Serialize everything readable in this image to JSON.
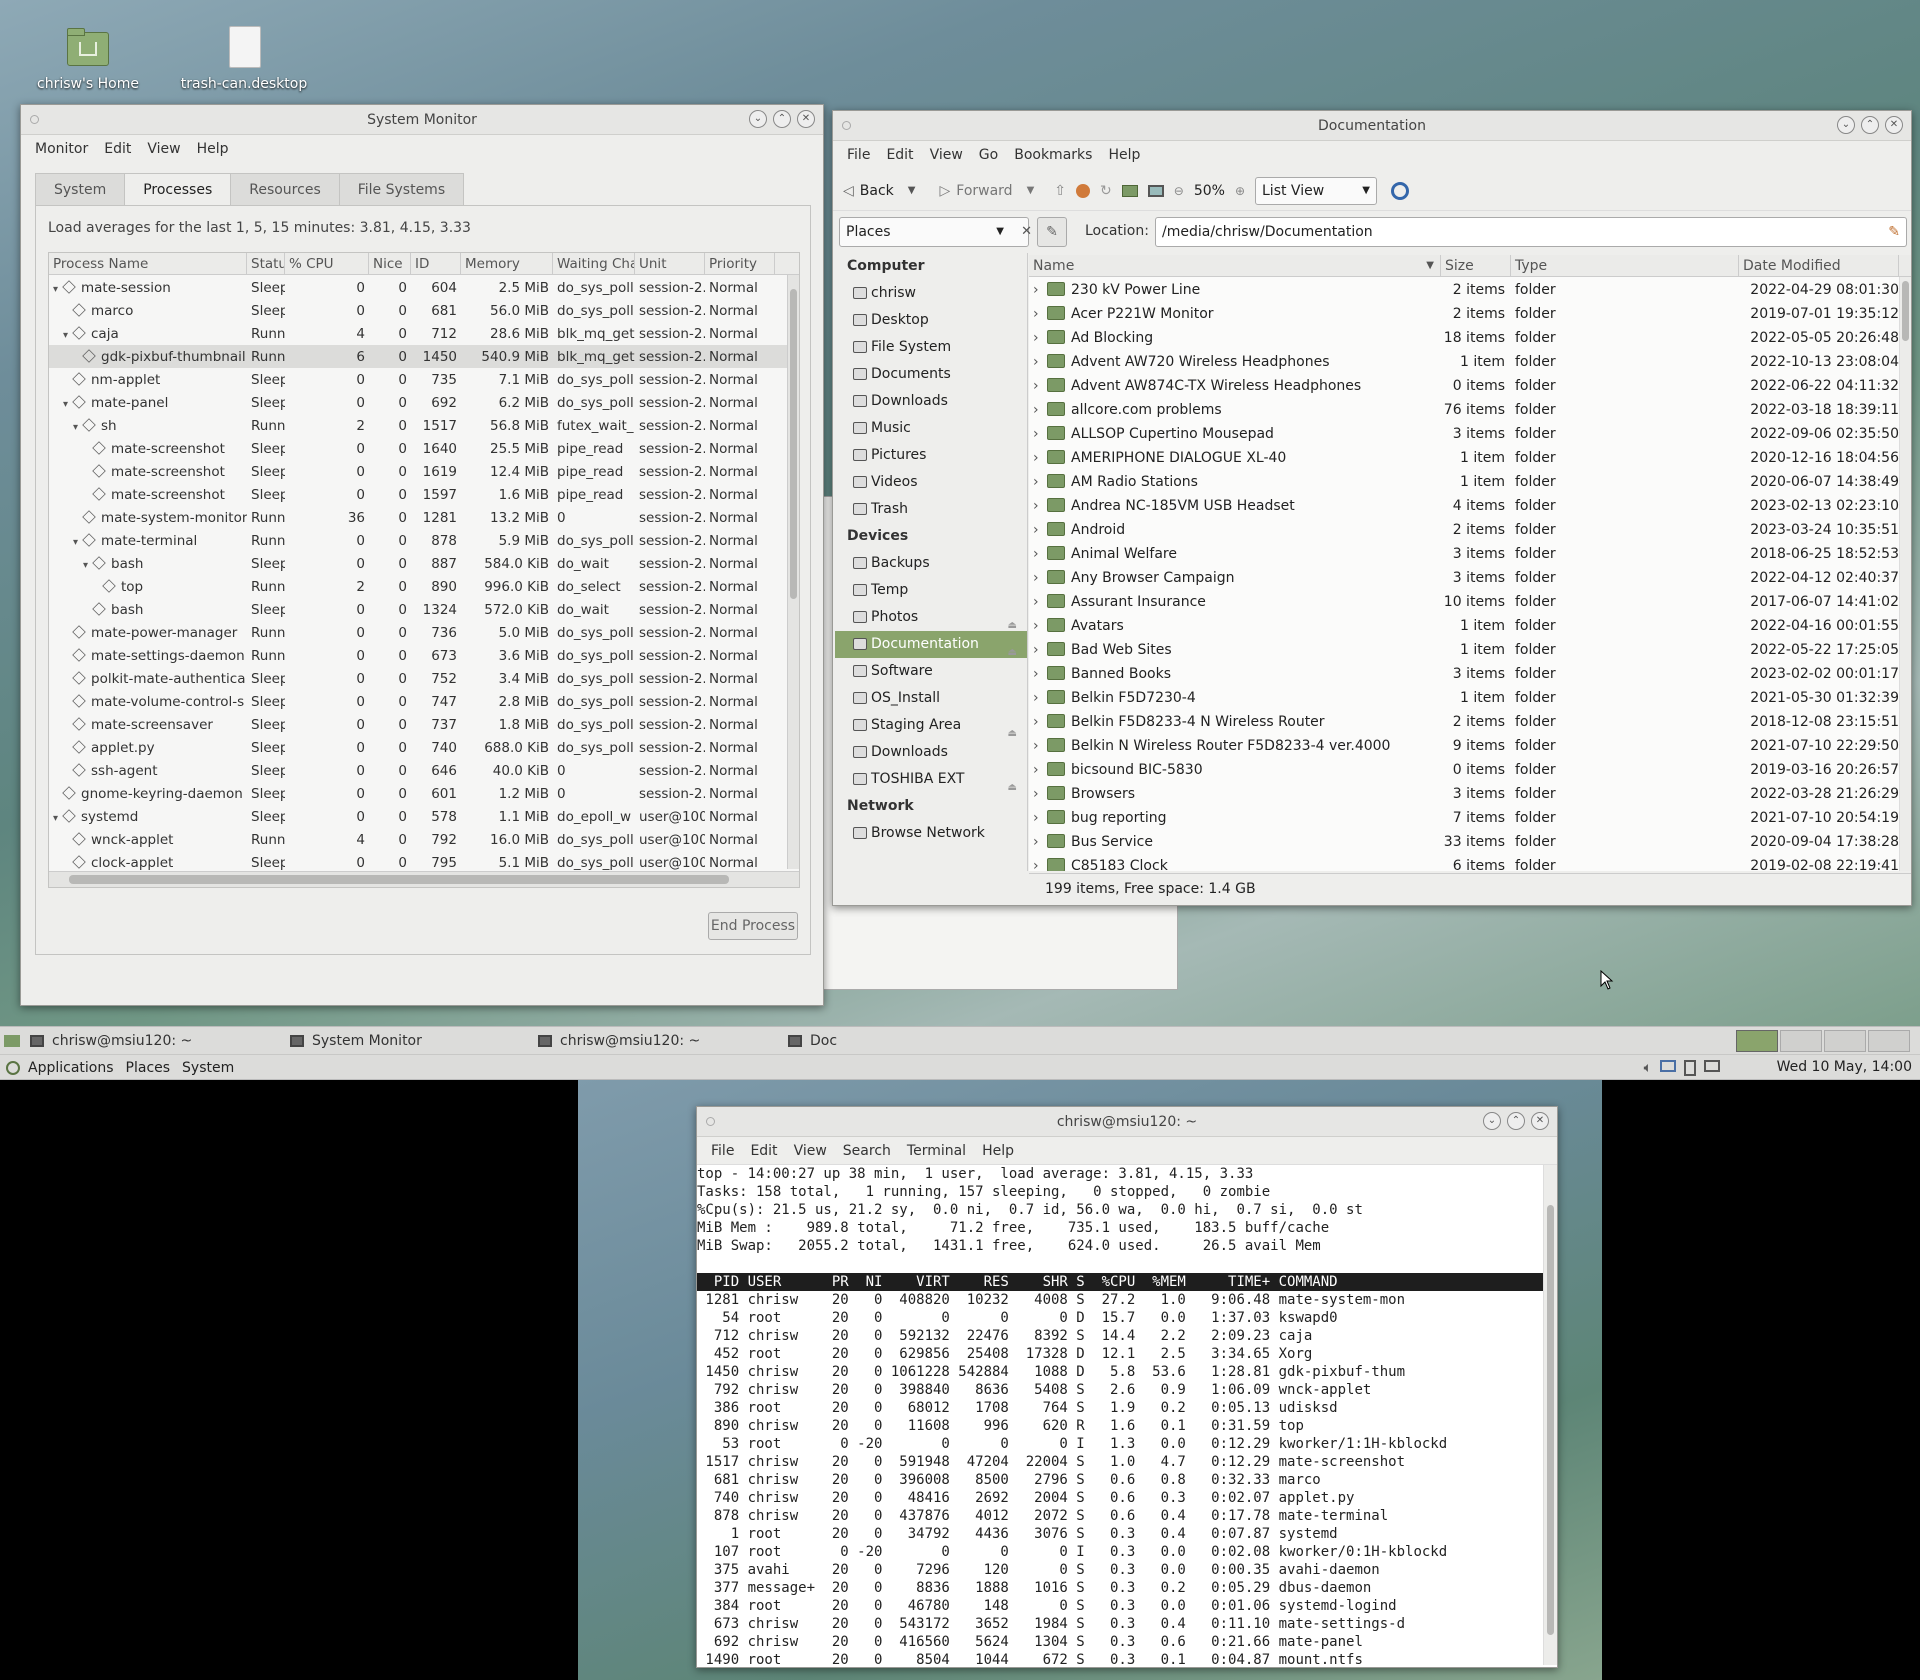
{
  "desktop": {
    "icons": [
      {
        "label": "chrisw's Home"
      },
      {
        "label": "trash-can.desktop"
      }
    ]
  },
  "sysmon": {
    "title": "System Monitor",
    "menu": [
      "Monitor",
      "Edit",
      "View",
      "Help"
    ],
    "tabs": [
      "System",
      "Processes",
      "Resources",
      "File Systems"
    ],
    "load_text": "Load averages for the last 1, 5, 15 minutes: 3.81, 4.15, 3.33",
    "columns": [
      "Process Name",
      "Statu",
      "% CPU",
      "Nice",
      "ID",
      "Memory",
      "Waiting Cha",
      "Unit",
      "Priority"
    ],
    "rows": [
      {
        "indent": 0,
        "exp": "▾",
        "name": "mate-session",
        "status": "Sleep",
        "cpu": "0",
        "nice": "0",
        "id": "604",
        "mem": "2.5 MiB",
        "wait": "do_sys_poll",
        "unit": "session-2.",
        "prio": "Normal"
      },
      {
        "indent": 1,
        "exp": "",
        "name": "marco",
        "status": "Sleep",
        "cpu": "0",
        "nice": "0",
        "id": "681",
        "mem": "56.0 MiB",
        "wait": "do_sys_poll",
        "unit": "session-2.",
        "prio": "Normal"
      },
      {
        "indent": 1,
        "exp": "▾",
        "name": "caja",
        "status": "Runn",
        "cpu": "4",
        "nice": "0",
        "id": "712",
        "mem": "28.6 MiB",
        "wait": "blk_mq_get",
        "unit": "session-2.",
        "prio": "Normal"
      },
      {
        "indent": 2,
        "exp": "",
        "name": "gdk-pixbuf-thumbnail",
        "status": "Runn",
        "cpu": "6",
        "nice": "0",
        "id": "1450",
        "mem": "540.9 MiB",
        "wait": "blk_mq_get",
        "unit": "session-2.",
        "prio": "Normal"
      },
      {
        "indent": 1,
        "exp": "",
        "name": "nm-applet",
        "status": "Sleep",
        "cpu": "0",
        "nice": "0",
        "id": "735",
        "mem": "7.1 MiB",
        "wait": "do_sys_poll",
        "unit": "session-2.",
        "prio": "Normal"
      },
      {
        "indent": 1,
        "exp": "▾",
        "name": "mate-panel",
        "status": "Sleep",
        "cpu": "0",
        "nice": "0",
        "id": "692",
        "mem": "6.2 MiB",
        "wait": "do_sys_poll",
        "unit": "session-2.",
        "prio": "Normal"
      },
      {
        "indent": 2,
        "exp": "▾",
        "name": "sh",
        "status": "Runn",
        "cpu": "2",
        "nice": "0",
        "id": "1517",
        "mem": "56.8 MiB",
        "wait": "futex_wait_",
        "unit": "session-2.",
        "prio": "Normal"
      },
      {
        "indent": 3,
        "exp": "",
        "name": "mate-screenshot",
        "status": "Sleep",
        "cpu": "0",
        "nice": "0",
        "id": "1640",
        "mem": "25.5 MiB",
        "wait": "pipe_read",
        "unit": "session-2.",
        "prio": "Normal"
      },
      {
        "indent": 3,
        "exp": "",
        "name": "mate-screenshot",
        "status": "Sleep",
        "cpu": "0",
        "nice": "0",
        "id": "1619",
        "mem": "12.4 MiB",
        "wait": "pipe_read",
        "unit": "session-2.",
        "prio": "Normal"
      },
      {
        "indent": 3,
        "exp": "",
        "name": "mate-screenshot",
        "status": "Sleep",
        "cpu": "0",
        "nice": "0",
        "id": "1597",
        "mem": "1.6 MiB",
        "wait": "pipe_read",
        "unit": "session-2.",
        "prio": "Normal"
      },
      {
        "indent": 2,
        "exp": "",
        "name": "mate-system-monitor",
        "status": "Runn",
        "cpu": "36",
        "nice": "0",
        "id": "1281",
        "mem": "13.2 MiB",
        "wait": "0",
        "unit": "session-2.",
        "prio": "Normal"
      },
      {
        "indent": 2,
        "exp": "▾",
        "name": "mate-terminal",
        "status": "Runn",
        "cpu": "0",
        "nice": "0",
        "id": "878",
        "mem": "5.9 MiB",
        "wait": "do_sys_poll",
        "unit": "session-2.",
        "prio": "Normal"
      },
      {
        "indent": 3,
        "exp": "▾",
        "name": "bash",
        "status": "Sleep",
        "cpu": "0",
        "nice": "0",
        "id": "887",
        "mem": "584.0 KiB",
        "wait": "do_wait",
        "unit": "session-2.",
        "prio": "Normal"
      },
      {
        "indent": 4,
        "exp": "",
        "name": "top",
        "status": "Runn",
        "cpu": "2",
        "nice": "0",
        "id": "890",
        "mem": "996.0 KiB",
        "wait": "do_select",
        "unit": "session-2.",
        "prio": "Normal"
      },
      {
        "indent": 3,
        "exp": "",
        "name": "bash",
        "status": "Sleep",
        "cpu": "0",
        "nice": "0",
        "id": "1324",
        "mem": "572.0 KiB",
        "wait": "do_wait",
        "unit": "session-2.",
        "prio": "Normal"
      },
      {
        "indent": 1,
        "exp": "",
        "name": "mate-power-manager",
        "status": "Runn",
        "cpu": "0",
        "nice": "0",
        "id": "736",
        "mem": "5.0 MiB",
        "wait": "do_sys_poll",
        "unit": "session-2.",
        "prio": "Normal"
      },
      {
        "indent": 1,
        "exp": "",
        "name": "mate-settings-daemon",
        "status": "Runn",
        "cpu": "0",
        "nice": "0",
        "id": "673",
        "mem": "3.6 MiB",
        "wait": "do_sys_poll",
        "unit": "session-2.",
        "prio": "Normal"
      },
      {
        "indent": 1,
        "exp": "",
        "name": "polkit-mate-authentica",
        "status": "Sleep",
        "cpu": "0",
        "nice": "0",
        "id": "752",
        "mem": "3.4 MiB",
        "wait": "do_sys_poll",
        "unit": "session-2.",
        "prio": "Normal"
      },
      {
        "indent": 1,
        "exp": "",
        "name": "mate-volume-control-s",
        "status": "Sleep",
        "cpu": "0",
        "nice": "0",
        "id": "747",
        "mem": "2.8 MiB",
        "wait": "do_sys_poll",
        "unit": "session-2.",
        "prio": "Normal"
      },
      {
        "indent": 1,
        "exp": "",
        "name": "mate-screensaver",
        "status": "Sleep",
        "cpu": "0",
        "nice": "0",
        "id": "737",
        "mem": "1.8 MiB",
        "wait": "do_sys_poll",
        "unit": "session-2.",
        "prio": "Normal"
      },
      {
        "indent": 1,
        "exp": "",
        "name": "applet.py",
        "status": "Sleep",
        "cpu": "0",
        "nice": "0",
        "id": "740",
        "mem": "688.0 KiB",
        "wait": "do_sys_poll",
        "unit": "session-2.",
        "prio": "Normal"
      },
      {
        "indent": 1,
        "exp": "",
        "name": "ssh-agent",
        "status": "Sleep",
        "cpu": "0",
        "nice": "0",
        "id": "646",
        "mem": "40.0 KiB",
        "wait": "0",
        "unit": "session-2.",
        "prio": "Normal"
      },
      {
        "indent": 0,
        "exp": "",
        "name": "gnome-keyring-daemon",
        "status": "Sleep",
        "cpu": "0",
        "nice": "0",
        "id": "601",
        "mem": "1.2 MiB",
        "wait": "0",
        "unit": "session-2.",
        "prio": "Normal"
      },
      {
        "indent": 0,
        "exp": "▾",
        "name": "systemd",
        "status": "Sleep",
        "cpu": "0",
        "nice": "0",
        "id": "578",
        "mem": "1.1 MiB",
        "wait": "do_epoll_w",
        "unit": "user@100",
        "prio": "Normal"
      },
      {
        "indent": 1,
        "exp": "",
        "name": "wnck-applet",
        "status": "Runn",
        "cpu": "4",
        "nice": "0",
        "id": "792",
        "mem": "16.0 MiB",
        "wait": "do_sys_poll",
        "unit": "user@100",
        "prio": "Normal"
      },
      {
        "indent": 1,
        "exp": "",
        "name": "clock-applet",
        "status": "Sleep",
        "cpu": "0",
        "nice": "0",
        "id": "795",
        "mem": "5.1 MiB",
        "wait": "do_sys_poll",
        "unit": "user@100",
        "prio": "Normal"
      }
    ],
    "end_button": "End Process"
  },
  "files": {
    "title": "Documentation",
    "menu": [
      "File",
      "Edit",
      "View",
      "Go",
      "Bookmarks",
      "Help"
    ],
    "toolbar": {
      "back": "Back",
      "forward": "Forward",
      "zoom": "50%",
      "view": "List View"
    },
    "places_label": "Places",
    "location_label": "Location:",
    "location_value": "/media/chrisw/Documentation",
    "sidebar": [
      {
        "type": "h",
        "label": "Computer"
      },
      {
        "type": "i",
        "label": "chrisw"
      },
      {
        "type": "i",
        "label": "Desktop"
      },
      {
        "type": "i",
        "label": "File System"
      },
      {
        "type": "i",
        "label": "Documents"
      },
      {
        "type": "i",
        "label": "Downloads"
      },
      {
        "type": "i",
        "label": "Music"
      },
      {
        "type": "i",
        "label": "Pictures"
      },
      {
        "type": "i",
        "label": "Videos"
      },
      {
        "type": "i",
        "label": "Trash"
      },
      {
        "type": "h",
        "label": "Devices"
      },
      {
        "type": "i",
        "label": "Backups"
      },
      {
        "type": "i",
        "label": "Temp"
      },
      {
        "type": "e",
        "label": "Photos"
      },
      {
        "type": "s",
        "label": "Documentation"
      },
      {
        "type": "i",
        "label": "Software"
      },
      {
        "type": "i",
        "label": "OS_Install"
      },
      {
        "type": "e",
        "label": "Staging Area"
      },
      {
        "type": "i",
        "label": "Downloads"
      },
      {
        "type": "e",
        "label": "TOSHIBA EXT"
      },
      {
        "type": "h",
        "label": "Network"
      },
      {
        "type": "i",
        "label": "Browse Network"
      }
    ],
    "columns": [
      "Name",
      "Size",
      "Type",
      "Date Modified"
    ],
    "rows": [
      [
        "230 kV Power Line",
        "2 items",
        "folder",
        "2022-04-29 08:01:30"
      ],
      [
        "Acer P221W Monitor",
        "2 items",
        "folder",
        "2019-07-01 19:35:12"
      ],
      [
        "Ad Blocking",
        "18 items",
        "folder",
        "2022-05-05 20:26:48"
      ],
      [
        "Advent AW720 Wireless Headphones",
        "1 item",
        "folder",
        "2022-10-13 23:08:04"
      ],
      [
        "Advent AW874C-TX Wireless Headphones",
        "0 items",
        "folder",
        "2022-06-22 04:11:32"
      ],
      [
        "allcore.com problems",
        "76 items",
        "folder",
        "2022-03-18 18:39:11"
      ],
      [
        "ALLSOP Cupertino Mousepad",
        "3 items",
        "folder",
        "2022-09-06 02:35:50"
      ],
      [
        "AMERIPHONE DIALOGUE XL-40",
        "1 item",
        "folder",
        "2020-12-16 18:04:56"
      ],
      [
        "AM Radio Stations",
        "1 item",
        "folder",
        "2020-06-07 14:38:49"
      ],
      [
        "Andrea NC-185VM USB Headset",
        "4 items",
        "folder",
        "2023-02-13 02:23:10"
      ],
      [
        "Android",
        "2 items",
        "folder",
        "2023-03-24 10:35:51"
      ],
      [
        "Animal Welfare",
        "3 items",
        "folder",
        "2018-06-25 18:52:53"
      ],
      [
        "Any Browser Campaign",
        "3 items",
        "folder",
        "2022-04-12 02:40:37"
      ],
      [
        "Assurant Insurance",
        "10 items",
        "folder",
        "2017-06-07 14:41:02"
      ],
      [
        "Avatars",
        "1 item",
        "folder",
        "2022-04-16 00:01:55"
      ],
      [
        "Bad Web Sites",
        "1 item",
        "folder",
        "2022-05-22 17:25:05"
      ],
      [
        "Banned Books",
        "3 items",
        "folder",
        "2023-02-02 00:01:17"
      ],
      [
        "Belkin F5D7230-4",
        "1 item",
        "folder",
        "2021-05-30 01:32:39"
      ],
      [
        "Belkin F5D8233-4 N Wireless Router",
        "2 items",
        "folder",
        "2018-12-08 23:15:51"
      ],
      [
        "Belkin N Wireless Router F5D8233-4 ver.4000",
        "9 items",
        "folder",
        "2021-07-10 22:29:50"
      ],
      [
        "bicsound BIC-5830",
        "0 items",
        "folder",
        "2019-03-16 20:26:57"
      ],
      [
        "Browsers",
        "3 items",
        "folder",
        "2022-03-28 21:26:29"
      ],
      [
        "bug reporting",
        "7 items",
        "folder",
        "2021-07-10 20:54:19"
      ],
      [
        "Bus Service",
        "33 items",
        "folder",
        "2020-09-04 17:38:28"
      ],
      [
        "C85183 Clock",
        "6 items",
        "folder",
        "2019-02-08 22:19:41"
      ]
    ],
    "status": "199 items, Free space: 1.4 GB"
  },
  "taskbar": {
    "items": [
      "chrisw@msiu120: ~",
      "System Monitor",
      "chrisw@msiu120: ~",
      "Doc"
    ]
  },
  "panel": {
    "menus": [
      "Applications",
      "Places",
      "System"
    ],
    "clock": "Wed 10 May, 14:00"
  },
  "terminal": {
    "title": "chrisw@msiu120: ~",
    "menu": [
      "File",
      "Edit",
      "View",
      "Search",
      "Terminal",
      "Help"
    ],
    "summary": [
      "top - 14:00:27 up 38 min,  1 user,  load average: 3.81, 4.15, 3.33",
      "Tasks: 158 total,   1 running, 157 sleeping,   0 stopped,   0 zombie",
      "%Cpu(s): 21.5 us, 21.2 sy,  0.0 ni,  0.7 id, 56.0 wa,  0.0 hi,  0.7 si,  0.0 st",
      "MiB Mem :    989.8 total,     71.2 free,    735.1 used,    183.5 buff/cache",
      "MiB Swap:   2055.2 total,   1431.1 free,    624.0 used.     26.5 avail Mem"
    ],
    "header": "  PID USER      PR  NI    VIRT    RES    SHR S  %CPU  %MEM     TIME+ COMMAND",
    "procs": [
      " 1281 chrisw    20   0  408820  10232   4008 S  27.2   1.0   9:06.48 mate-system-mon",
      "   54 root      20   0       0      0      0 D  15.7   0.0   1:37.03 kswapd0",
      "  712 chrisw    20   0  592132  22476   8392 S  14.4   2.2   2:09.23 caja",
      "  452 root      20   0  629856  25408  17328 D  12.1   2.5   3:34.65 Xorg",
      " 1450 chrisw    20   0 1061228 542884   1088 D   5.8  53.6   1:28.81 gdk-pixbuf-thum",
      "  792 chrisw    20   0  398840   8636   5408 S   2.6   0.9   1:06.09 wnck-applet",
      "  386 root      20   0   68012   1708    764 S   1.9   0.2   0:05.13 udisksd",
      "  890 chrisw    20   0   11608    996    620 R   1.6   0.1   0:31.59 top",
      "   53 root       0 -20       0      0      0 I   1.3   0.0   0:12.29 kworker/1:1H-kblockd",
      " 1517 chrisw    20   0  591948  47204  22004 S   1.0   4.7   0:12.29 mate-screenshot",
      "  681 chrisw    20   0  396008   8500   2796 S   0.6   0.8   0:32.33 marco",
      "  740 chrisw    20   0   48416   2692   2004 S   0.6   0.3   0:02.07 applet.py",
      "  878 chrisw    20   0  437876   4012   2072 S   0.6   0.4   0:17.78 mate-terminal",
      "    1 root      20   0   34792   4436   3076 S   0.3   0.4   0:07.87 systemd",
      "  107 root       0 -20       0      0      0 I   0.3   0.0   0:02.08 kworker/0:1H-kblockd",
      "  375 avahi     20   0    7296    120      0 S   0.3   0.0   0:00.35 avahi-daemon",
      "  377 message+  20   0    8836   1888   1016 S   0.3   0.2   0:05.29 dbus-daemon",
      "  384 root      20   0   46780    148      0 S   0.3   0.0   0:01.06 systemd-logind",
      "  673 chrisw    20   0  543172   3652   1984 S   0.3   0.4   0:11.10 mate-settings-d",
      "  692 chrisw    20   0  416560   5624   1304 S   0.3   0.6   0:21.66 mate-panel",
      " 1490 root      20   0    8504   1044    672 S   0.3   0.1   0:04.87 mount.ntfs"
    ]
  }
}
